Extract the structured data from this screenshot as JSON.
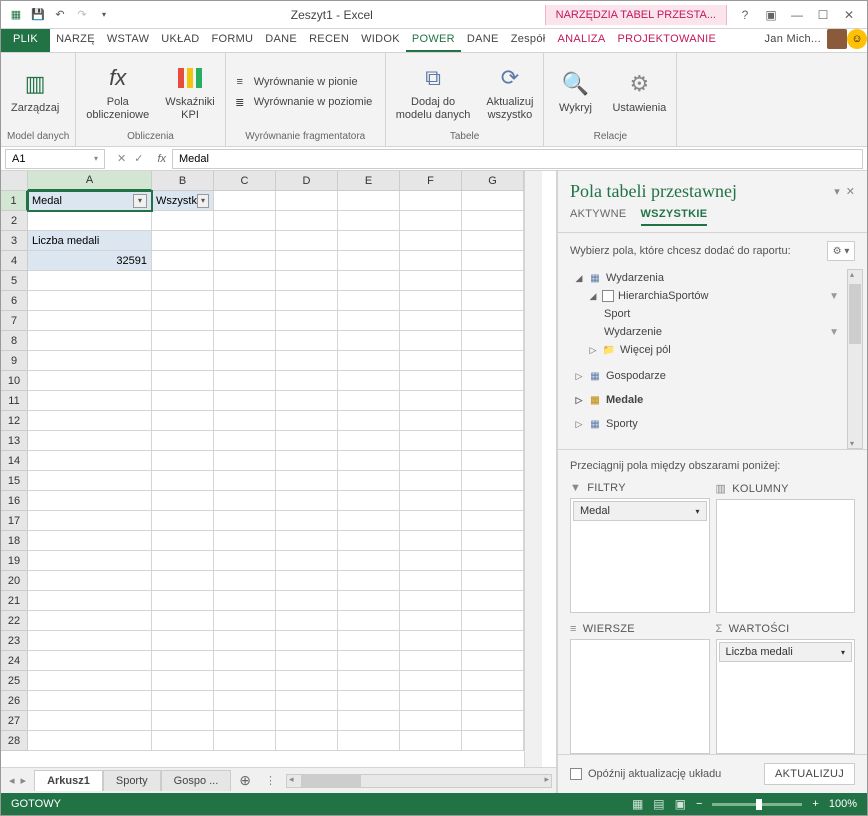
{
  "title": "Zeszyt1 - Excel",
  "tool_tab_title": "NARZĘDZIA TABEL PRZESTA...",
  "user_name": "Jan Mich...",
  "main_tabs": {
    "file": "PLIK",
    "narze": "NARZĘ",
    "wstaw": "WSTAW",
    "uklad": "UKŁAD",
    "formu": "FORMU",
    "dane": "DANE",
    "recen": "RECEN",
    "widok": "WIDOK",
    "power": "POWER",
    "dane2": "DANE",
    "zespol": "Zespół",
    "analiza": "ANALIZA",
    "projekt": "PROJEKTOWANIE"
  },
  "ribbon": {
    "g1": {
      "btn": "Zarządzaj",
      "label": "Model danych"
    },
    "g2": {
      "btn1": "Pola\nobliczeniowe",
      "btn2": "Wskaźniki\nKPI",
      "label": "Obliczenia"
    },
    "g3": {
      "i1": "Wyrównanie w pionie",
      "i2": "Wyrównanie w poziomie",
      "label": "Wyrównanie fragmentatora"
    },
    "g4": {
      "btn1": "Dodaj do\nmodelu danych",
      "btn2": "Aktualizuj\nwszystko",
      "label": "Tabele"
    },
    "g5": {
      "btn1": "Wykryj",
      "btn2": "Ustawienia",
      "label": "Relacje"
    }
  },
  "name_box": "A1",
  "formula": "Medal",
  "columns": [
    "A",
    "B",
    "C",
    "D",
    "E",
    "F",
    "G"
  ],
  "rows": [
    "1",
    "2",
    "3",
    "4",
    "5",
    "6",
    "7",
    "8",
    "9",
    "10",
    "11",
    "12",
    "13",
    "14",
    "15",
    "16",
    "17",
    "18",
    "19",
    "20",
    "21",
    "22",
    "23",
    "24",
    "25",
    "26",
    "27",
    "28"
  ],
  "cells": {
    "a1": "Medal",
    "b1": "Wszystk",
    "a3": "Liczba medali",
    "a4": "32591"
  },
  "sheet_tabs": {
    "s1": "Arkusz1",
    "s2": "Sporty",
    "s3": "Gospo ..."
  },
  "pane": {
    "title": "Pola tabeli przestawnej",
    "tab_active": "AKTYWNE",
    "tab_all": "WSZYSTKIE",
    "choose": "Wybierz pola, które chcesz dodać do raportu:",
    "fields": {
      "wydarzenia": "Wydarzenia",
      "hier": "HierarchiaSportów",
      "sport": "Sport",
      "wyd": "Wydarzenie",
      "wiecej": "Więcej pól",
      "gosp": "Gospodarze",
      "medale": "Medale",
      "sporty": "Sporty"
    },
    "drag": "Przeciągnij pola między obszarami poniżej:",
    "areas": {
      "filtry": "FILTRY",
      "kolumny": "KOLUMNY",
      "wiersze": "WIERSZE",
      "wartosci": "WARTOŚCI"
    },
    "filter_item": "Medal",
    "value_item": "Liczba medali",
    "defer": "Opóźnij aktualizację układu",
    "update": "AKTUALIZUJ"
  },
  "status": {
    "ready": "GOTOWY",
    "zoom": "100%"
  }
}
